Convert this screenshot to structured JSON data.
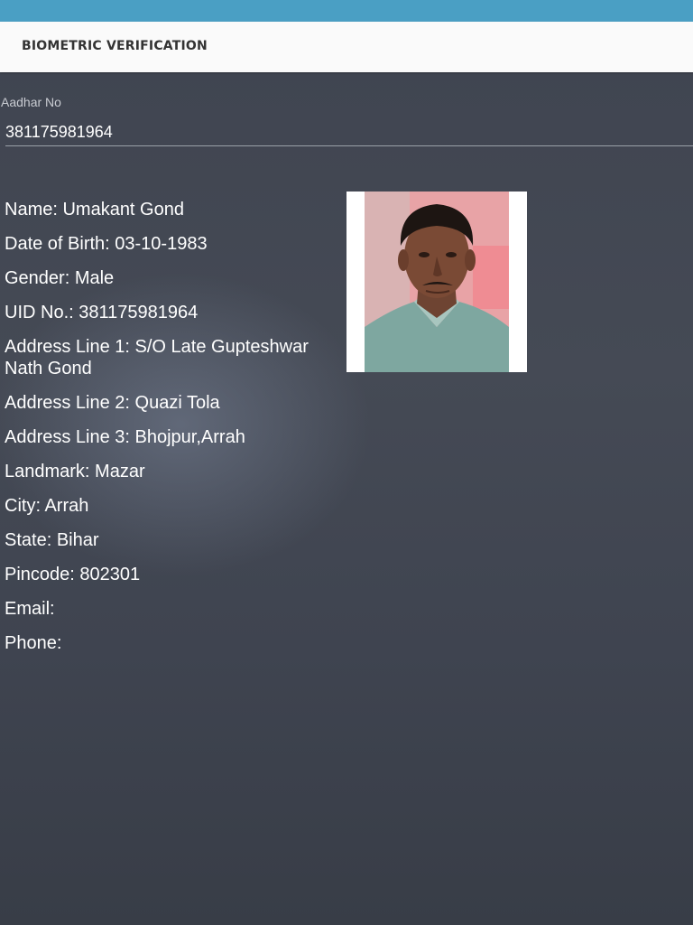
{
  "app": {
    "title": "BIOMETRIC VERIFICATION"
  },
  "aadhar": {
    "label": "Aadhar No",
    "value": "381175981964"
  },
  "details": [
    "Name: Umakant Gond",
    "Date of Birth: 03-10-1983",
    "Gender: Male",
    "UID No.: 381175981964",
    "Address Line 1: S/O Late Gupteshwar Nath Gond",
    "Address Line 2: Quazi Tola",
    "Address Line 3: Bhojpur,Arrah",
    "Landmark: Mazar",
    "City: Arrah",
    "State: Bihar",
    "Pincode: 802301",
    "Email:",
    "Phone:"
  ],
  "colors": {
    "status_bar": "#4a9fc4",
    "app_bar": "#fafafa",
    "background": "#434853",
    "text": "#ffffff"
  }
}
